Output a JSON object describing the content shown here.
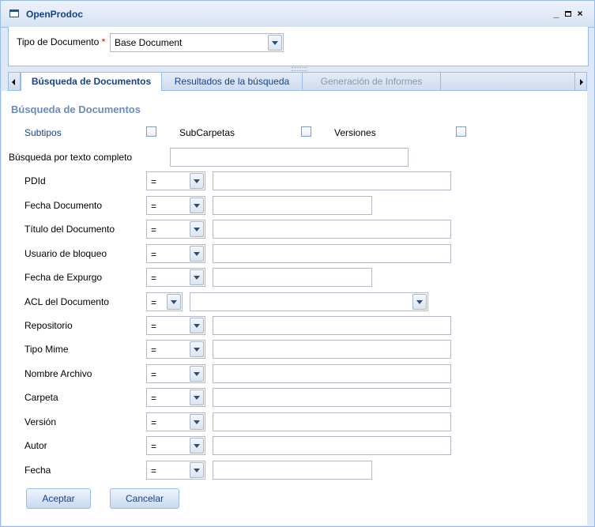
{
  "window": {
    "title": "OpenProdoc",
    "minimize": "_",
    "close": "×"
  },
  "doc_type": {
    "label": "Tipo de Documento",
    "required_mark": "*",
    "value": "Base Document"
  },
  "tabs": [
    {
      "label": "Búsqueda de Documentos",
      "state": "active"
    },
    {
      "label": "Resultados de la búsqueda",
      "state": "normal"
    },
    {
      "label": "Generación de Informes",
      "state": "disabled"
    }
  ],
  "search": {
    "section_title": "Búsqueda de Documentos",
    "checkboxes": [
      {
        "label": "Subtipos"
      },
      {
        "label": "SubCarpetas"
      },
      {
        "label": "Versiones"
      }
    ],
    "fulltext_label": "Búsqueda por texto completo",
    "fields": [
      {
        "label": "PDId",
        "op": "="
      },
      {
        "label": "Fecha Documento",
        "op": "="
      },
      {
        "label": "Título del Documento",
        "op": "="
      },
      {
        "label": "Usuario de bloqueo",
        "op": "="
      },
      {
        "label": "Fecha de Expurgo",
        "op": "="
      },
      {
        "label": "ACL del Documento",
        "op": "="
      },
      {
        "label": "Repositorio",
        "op": "="
      },
      {
        "label": "Tipo Mime",
        "op": "="
      },
      {
        "label": "Nombre Archivo",
        "op": "="
      },
      {
        "label": "Carpeta",
        "op": "="
      },
      {
        "label": "Versión",
        "op": "="
      },
      {
        "label": "Autor",
        "op": "="
      },
      {
        "label": "Fecha",
        "op": "="
      }
    ]
  },
  "buttons": {
    "accept": "Aceptar",
    "cancel": "Cancelar"
  }
}
